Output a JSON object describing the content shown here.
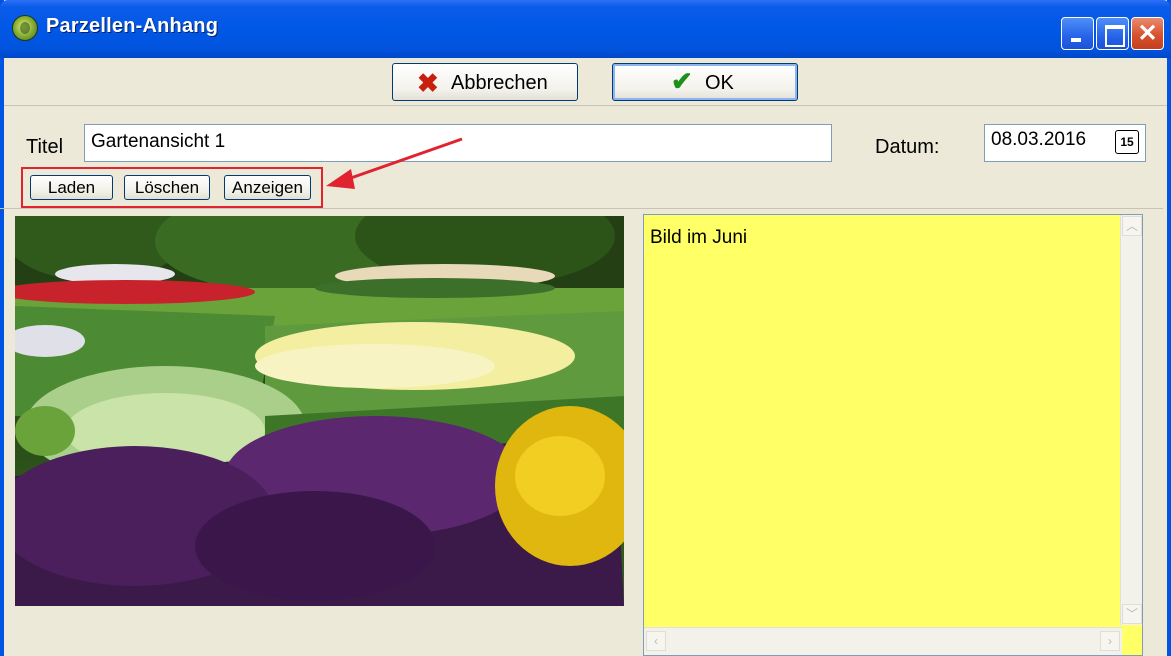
{
  "window": {
    "title": "Parzellen-Anhang",
    "controls": {
      "minimize": "minimize",
      "maximize": "maximize",
      "close": "close"
    }
  },
  "toolbar": {
    "cancel_label": "Abbrechen",
    "ok_label": "OK"
  },
  "form": {
    "titel_label": "Titel",
    "titel_value": "Gartenansicht 1",
    "datum_label": "Datum:",
    "datum_value": "08.03.2016",
    "calendar_icon_text": "15"
  },
  "image_buttons": {
    "load": "Laden",
    "delete": "Löschen",
    "show": "Anzeigen"
  },
  "memo": {
    "text": "Bild im Juni"
  },
  "colors": {
    "memo_background": "#ffff66",
    "highlight": "#e0242f",
    "titlebar": "#0058e6"
  }
}
